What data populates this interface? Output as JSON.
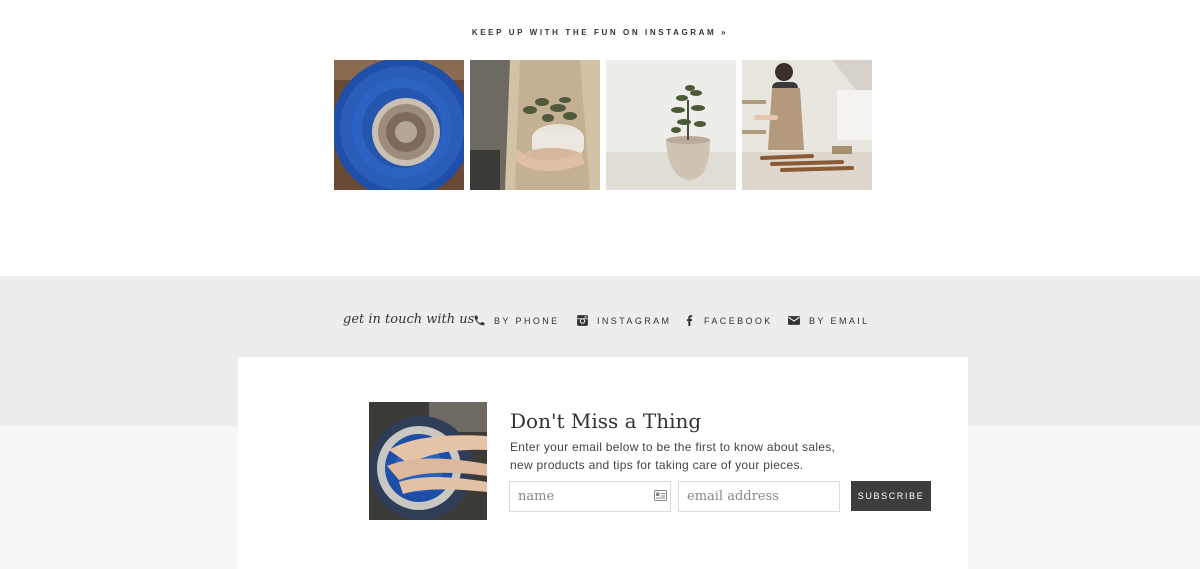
{
  "instagram": {
    "link_label": "KEEP UP WITH THE FUN ON INSTAGRAM »",
    "photos": [
      {
        "name": "pottery-wheel-bowl-photo"
      },
      {
        "name": "hands-holding-plant-pot-photo"
      },
      {
        "name": "potted-succulent-photo"
      },
      {
        "name": "potter-in-studio-photo"
      }
    ]
  },
  "contact": {
    "label": "get in touch with us",
    "items": [
      {
        "label": "BY PHONE",
        "icon": "phone-icon"
      },
      {
        "label": "INSTAGRAM",
        "icon": "instagram-icon"
      },
      {
        "label": "FACEBOOK",
        "icon": "facebook-icon"
      },
      {
        "label": "BY EMAIL",
        "icon": "envelope-icon"
      }
    ]
  },
  "newsletter": {
    "title": "Don't Miss a Thing",
    "description": "Enter your email below to be the first to know about sales, new products and tips for taking care of your pieces.",
    "name_placeholder": "name",
    "email_placeholder": "email address",
    "subscribe_label": "SUBSCRIBE",
    "photo": "hands-on-pottery-wheel-photo"
  },
  "colors": {
    "band_bg": "#ededed",
    "button_bg": "#3d3d3d",
    "text": "#333333",
    "pottery_blue": "#2a5db0"
  }
}
